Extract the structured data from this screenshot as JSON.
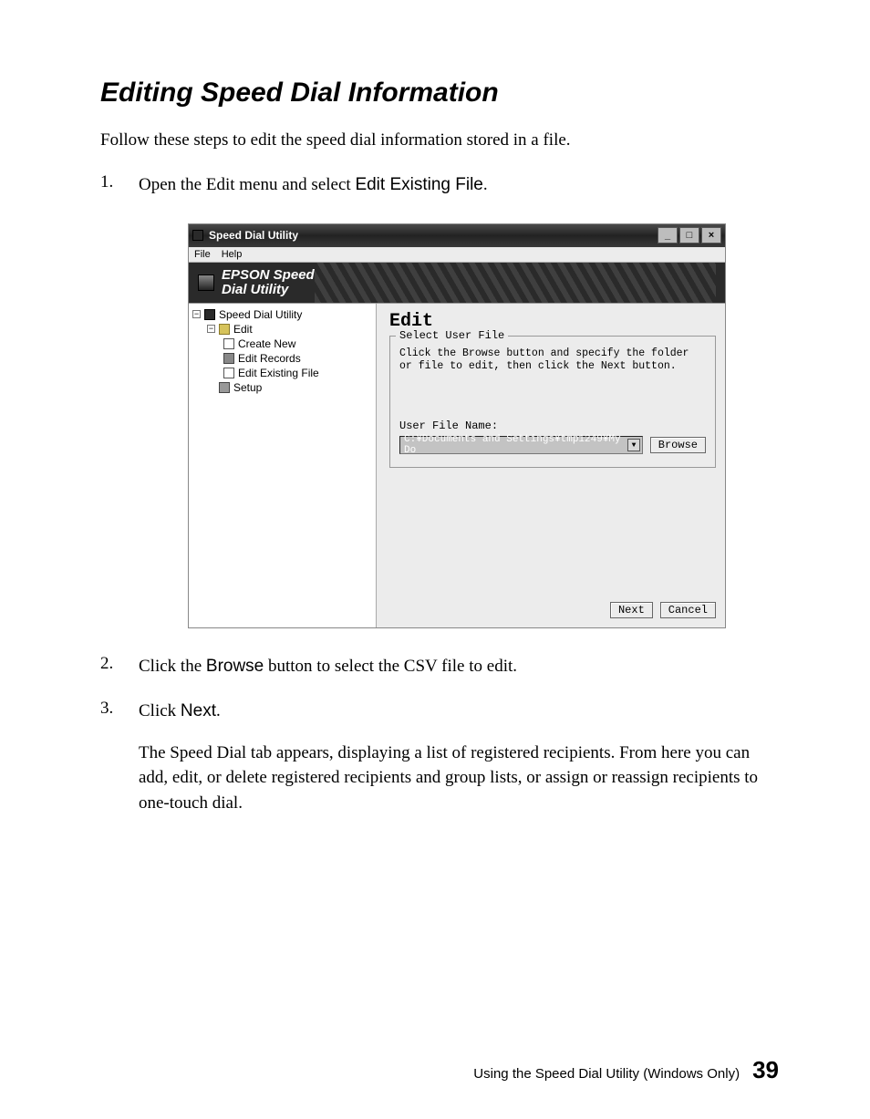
{
  "heading": "Editing Speed Dial Information",
  "intro": "Follow these steps to edit the speed dial information stored in a file.",
  "steps": {
    "n1": "1.",
    "s1_a": "Open the Edit menu and select ",
    "s1_b": "Edit Existing File",
    "s1_c": ".",
    "n2": "2.",
    "s2_a": "Click the ",
    "s2_b": "Browse",
    "s2_c": " button to select the CSV file to edit.",
    "n3": "3.",
    "s3_a": "Click ",
    "s3_b": "Next",
    "s3_c": ".",
    "s3_para": "The Speed Dial tab appears, displaying a list of registered recipients. From here you can add, edit, or delete registered recipients and group lists, or assign or reassign recipients to one-touch dial."
  },
  "win": {
    "title": "Speed Dial Utility",
    "min": "_",
    "max": "□",
    "close": "×",
    "menu": {
      "file": "File",
      "help": "Help"
    },
    "banner1": "EPSON Speed",
    "banner2": "Dial Utility",
    "tree": {
      "root": "Speed Dial Utility",
      "edit": "Edit",
      "create": "Create New",
      "records": "Edit Records",
      "existing": "Edit Existing File",
      "setup": "Setup",
      "minus": "−"
    },
    "pane": {
      "title": "Edit",
      "legend": "Select User File",
      "instr": "Click the Browse button and specify the folder or file to edit, then click the Next button.",
      "ufn": "User File Name:",
      "path": "C:¥Documents and Settings¥tmp1249¥My Do",
      "browse": "Browse",
      "next": "Next",
      "cancel": "Cancel",
      "arrow": "▼"
    }
  },
  "footer": {
    "text": "Using the Speed Dial Utility (Windows Only)",
    "page": "39"
  }
}
